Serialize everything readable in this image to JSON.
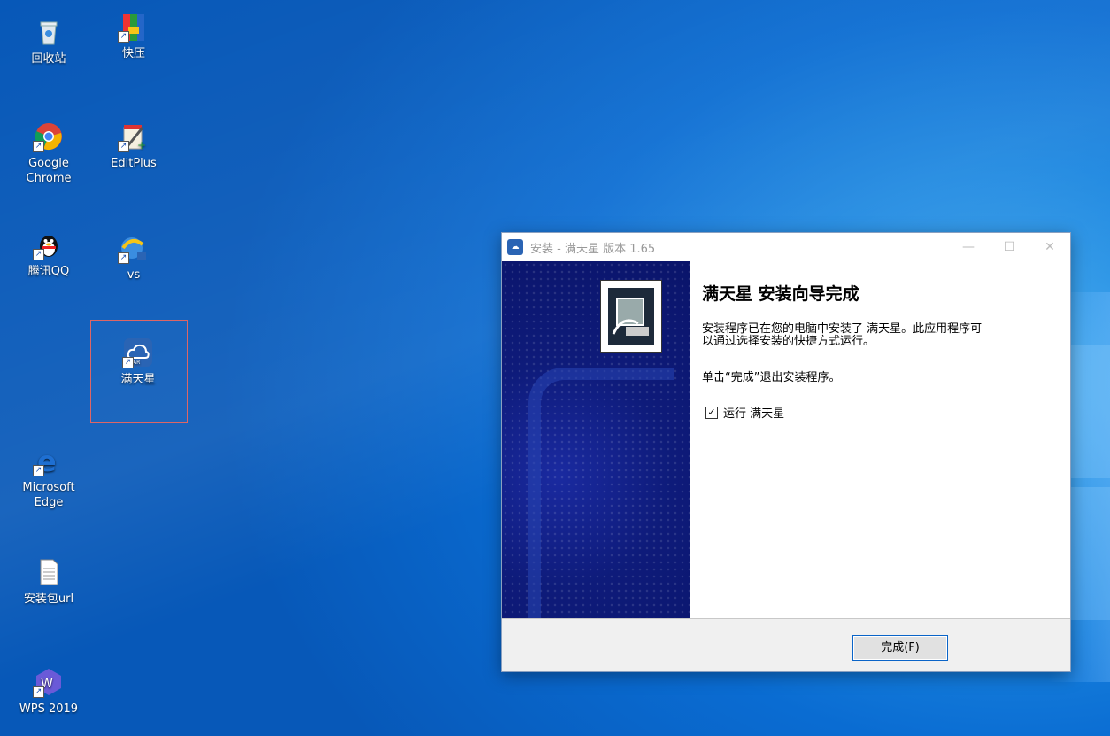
{
  "desktop": {
    "icons": [
      {
        "label": "回收站"
      },
      {
        "label": "快压"
      },
      {
        "label": "Google Chrome"
      },
      {
        "label": "EditPlus"
      },
      {
        "label": "腾讯QQ"
      },
      {
        "label": "vs"
      },
      {
        "label": "满天星"
      },
      {
        "label": "Microsoft Edge"
      },
      {
        "label": "安装包url"
      },
      {
        "label": "WPS 2019"
      }
    ]
  },
  "installer": {
    "title": "安装 - 满天星 版本 1.65",
    "heading": "满天星  安装向导完成",
    "message_line1": "安装程序已在您的电脑中安装了 满天星。此应用程序可",
    "message_line2": "以通过选择安装的快捷方式运行。",
    "exit_hint": "单击“完成”退出安装程序。",
    "run_checkbox_label": "运行 满天星",
    "run_checked": true,
    "finish_button_label": "完成(F)"
  }
}
